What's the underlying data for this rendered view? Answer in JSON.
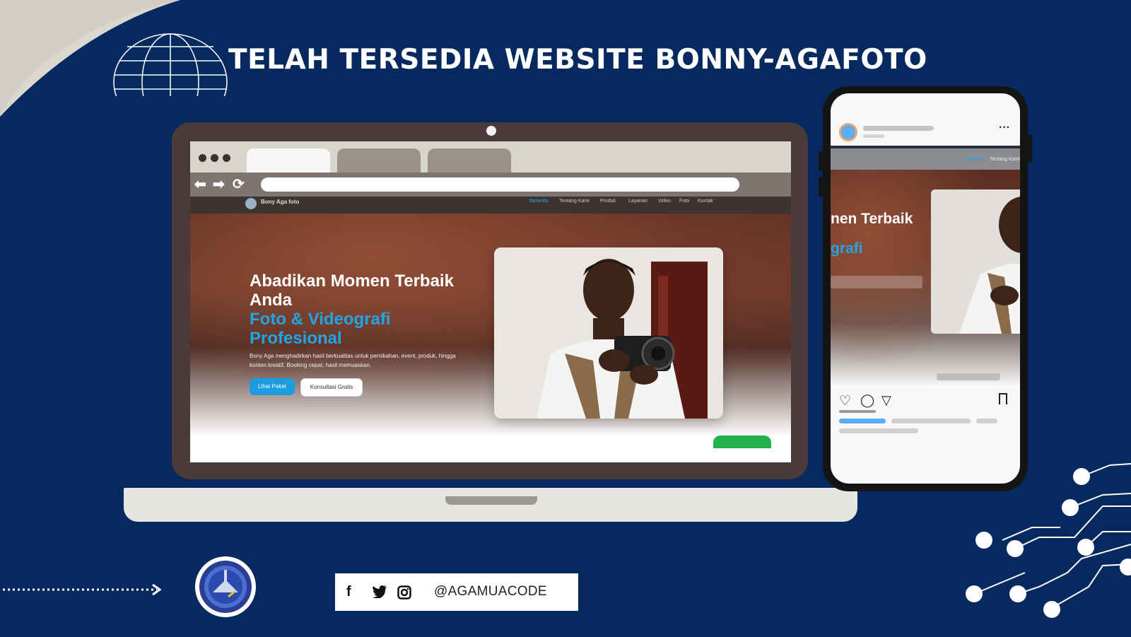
{
  "banner": {
    "headline": "TELAH TERSEDIA WEBSITE BONNY-AGAFOTO"
  },
  "browser": {
    "site_brand": "Bony Aga foto",
    "nav_items": [
      "Beranda",
      "Tentang Kami",
      "Produk",
      "Layanan",
      "Video",
      "Foto",
      "Kontak"
    ]
  },
  "hero": {
    "title": "Abadikan Momen Terbaik Anda",
    "subtitle": "Foto & Videografi Profesional",
    "description": "Bony Aga menghadirkan hasil berkualitas untuk pernikahan, event, produk, hingga konten kreatif. Booking cepat, hasil memuaskan.",
    "primary_button": "Lihat Paket",
    "secondary_button": "Konsultasi Gratis"
  },
  "phone": {
    "nav_items": [
      "Beranda",
      "Tentang Kami"
    ],
    "title_fragment": "nen Terbaik",
    "subtitle_fragment": "grafi"
  },
  "social": {
    "handle": "@AGAMUACODE",
    "icons": [
      "facebook-icon",
      "twitter-icon",
      "instagram-icon"
    ]
  },
  "colors": {
    "background": "#062a5f",
    "accent_blue": "#22a4e8",
    "button_blue": "#1c9ce0",
    "green": "#22b14c"
  }
}
